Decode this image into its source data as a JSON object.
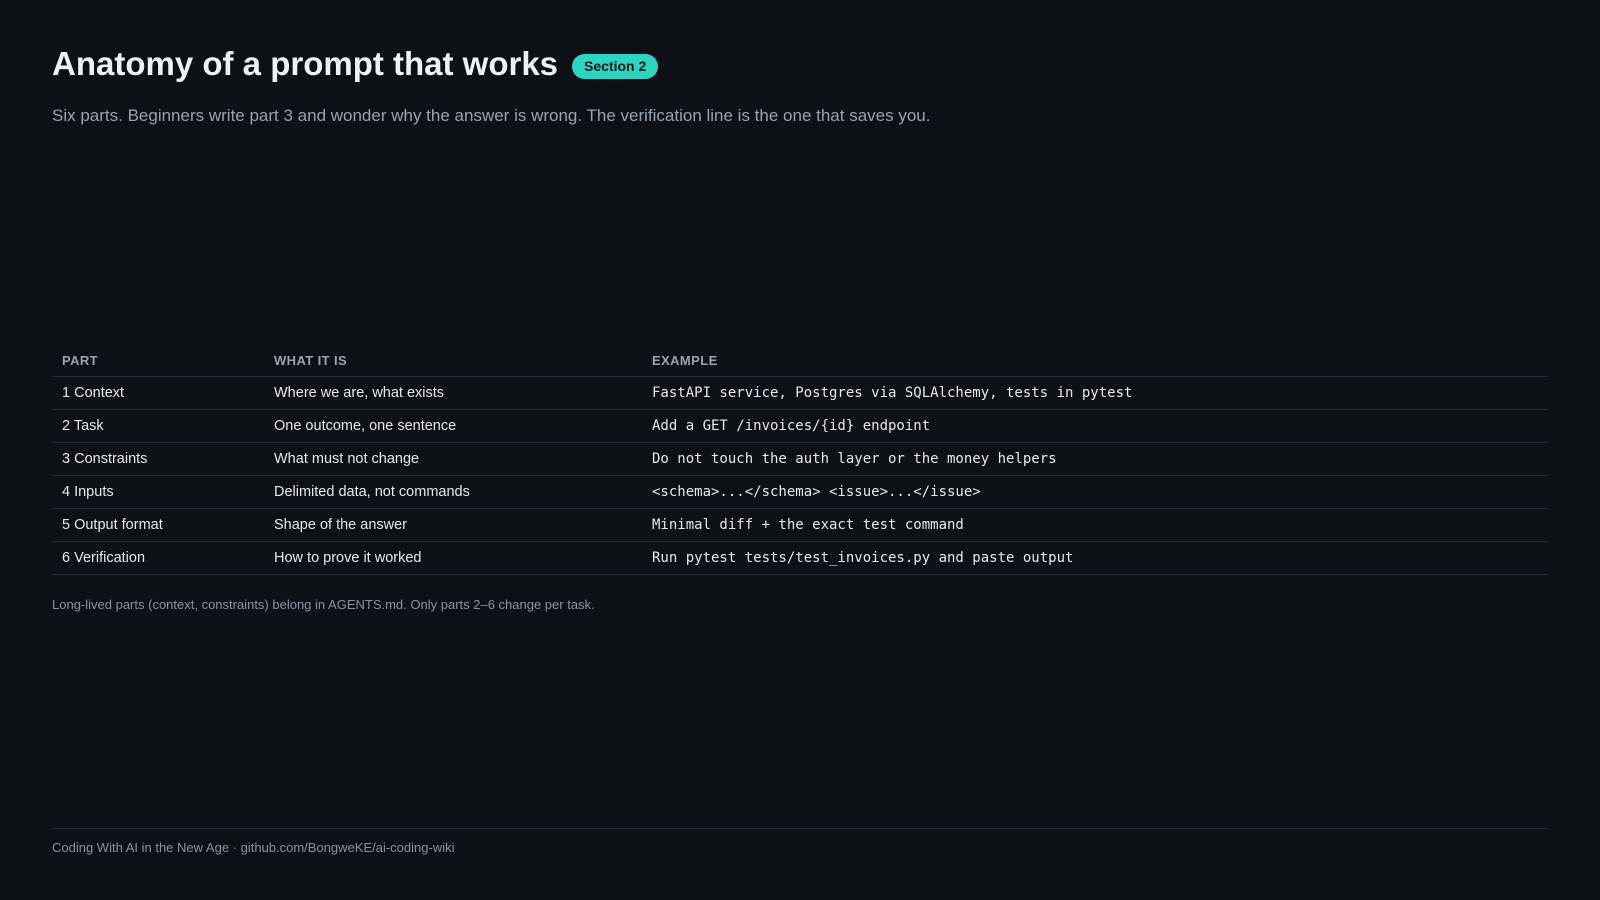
{
  "header": {
    "title": "Anatomy of a prompt that works",
    "badge": "Section 2",
    "subtitle": "Six parts. Beginners write part 3 and wonder why the answer is wrong. The verification line is the one that saves you."
  },
  "table": {
    "columns": [
      "PART",
      "WHAT IT IS",
      "EXAMPLE"
    ],
    "rows": [
      {
        "part": "1 Context",
        "what": "Where we are, what exists",
        "example": "FastAPI service, Postgres via SQLAlchemy, tests in pytest"
      },
      {
        "part": "2 Task",
        "what": "One outcome, one sentence",
        "example": "Add a GET /invoices/{id} endpoint"
      },
      {
        "part": "3 Constraints",
        "what": "What must not change",
        "example": "Do not touch the auth layer or the money helpers"
      },
      {
        "part": "4 Inputs",
        "what": "Delimited data, not commands",
        "example": "<schema>...</schema> <issue>...</issue>"
      },
      {
        "part": "5 Output format",
        "what": "Shape of the answer",
        "example": "Minimal diff + the exact test command"
      },
      {
        "part": "6 Verification",
        "what": "How to prove it worked",
        "example": "Run pytest tests/test_invoices.py and paste output"
      }
    ]
  },
  "note": "Long-lived parts (context, constraints) belong in AGENTS.md. Only parts 2–6 change per task.",
  "footer": "Coding With AI in the New Age · github.com/BongweKE/ai-coding-wiki",
  "colors": {
    "background": "#0d1017",
    "accent": "#2dd4bf"
  }
}
